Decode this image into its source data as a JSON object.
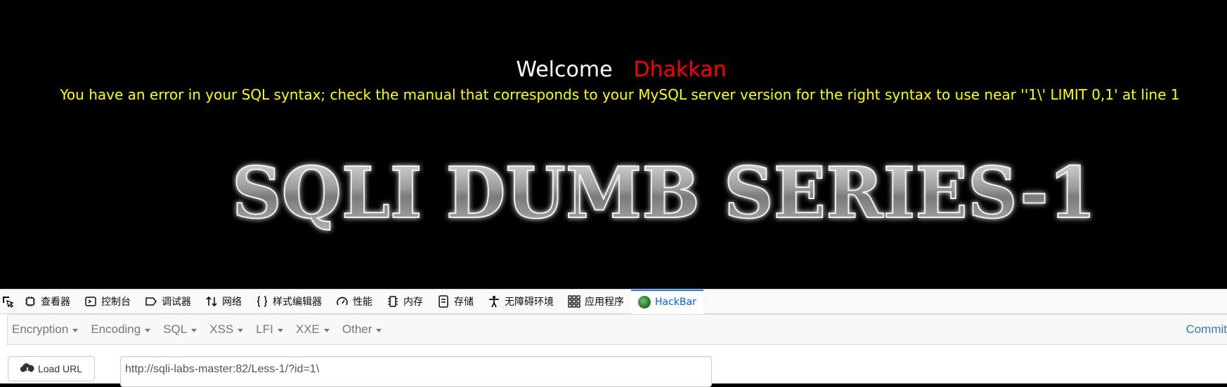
{
  "page": {
    "welcome_text": "Welcome",
    "user_name": "Dhakkan",
    "error_message": "You have an error in your SQL syntax; check the manual that corresponds to your MySQL server version for the right syntax to use near ''1\\' LIMIT 0,1' at line 1",
    "banner_text": "SQLI DUMB SERIES-1",
    "colors": {
      "background": "#000000",
      "welcome": "#ffffff",
      "name": "#ff0000",
      "error": "#ffff00"
    }
  },
  "devtools": {
    "tabs": [
      {
        "label": "查看器",
        "icon": "inspector-icon"
      },
      {
        "label": "控制台",
        "icon": "console-icon"
      },
      {
        "label": "调试器",
        "icon": "debugger-icon"
      },
      {
        "label": "网络",
        "icon": "network-icon"
      },
      {
        "label": "样式编辑器",
        "icon": "style-editor-icon"
      },
      {
        "label": "性能",
        "icon": "performance-icon"
      },
      {
        "label": "内存",
        "icon": "memory-icon"
      },
      {
        "label": "存储",
        "icon": "storage-icon"
      },
      {
        "label": "无障碍环境",
        "icon": "accessibility-icon"
      },
      {
        "label": "应用程序",
        "icon": "application-icon"
      },
      {
        "label": "HackBar",
        "icon": "hackbar-icon",
        "active": true
      }
    ]
  },
  "hackbar": {
    "menu": [
      "Encryption",
      "Encoding",
      "SQL",
      "XSS",
      "LFI",
      "XXE",
      "Other"
    ],
    "commit_label": "Commit",
    "load_url_label": "Load URL",
    "url_value": "http://sqli-labs-master:82/Less-1/?id=1\\",
    "accent": "#337ab7"
  }
}
